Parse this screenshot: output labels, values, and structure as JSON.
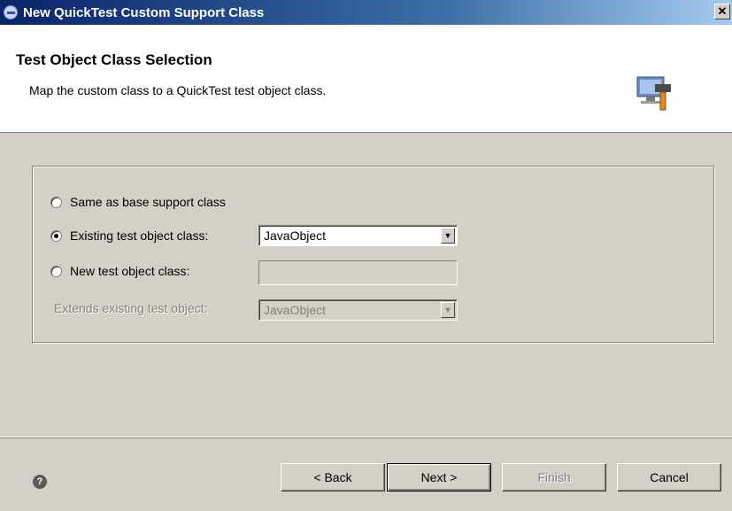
{
  "window": {
    "title": "New QuickTest Custom Support Class",
    "close_glyph": "✕"
  },
  "header": {
    "title": "Test Object Class Selection",
    "subtitle": "Map the custom class to a QuickTest test object class.",
    "icon": "wizard-banner-icon"
  },
  "options": {
    "same_as_base": {
      "label": "Same as base support class",
      "checked": false
    },
    "existing": {
      "label": "Existing test object class:",
      "checked": true,
      "value": "JavaObject"
    },
    "new": {
      "label": "New test object class:",
      "checked": false,
      "value": ""
    },
    "extends": {
      "label": "Extends existing test object:",
      "value": "JavaObject",
      "disabled": true
    }
  },
  "footer": {
    "help_glyph": "?",
    "back": "< Back",
    "next": "Next >",
    "finish": "Finish",
    "cancel": "Cancel"
  }
}
